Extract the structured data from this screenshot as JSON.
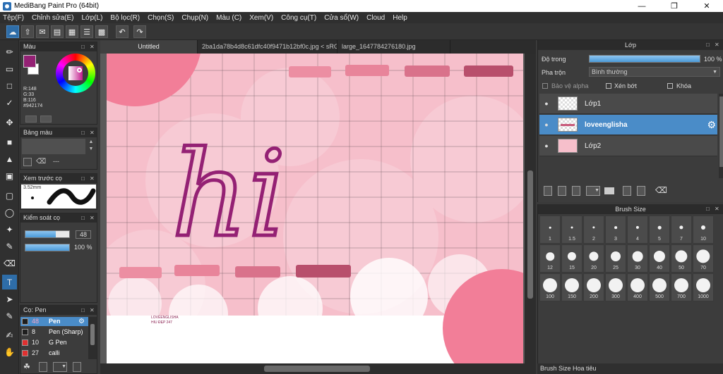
{
  "window": {
    "title": "MediBang Paint Pro (64bit)"
  },
  "menu": [
    "Tệp(F)",
    "Chỉnh sửa(E)",
    "Lớp(L)",
    "Bộ lọc(R)",
    "Chọn(S)",
    "Chụp(N)",
    "Màu (C)",
    "Xem(V)",
    "Công cụ(T)",
    "Cửa sổ(W)",
    "Cloud",
    "Help"
  ],
  "tabs": [
    {
      "label": "Untitled"
    },
    {
      "label": "2ba1da78b4d8c61dfc40f9471b12bf0c.jpg < sRGB >"
    },
    {
      "label": "large_1647784276180.jpg"
    }
  ],
  "color_panel": {
    "title": "Màu",
    "r": "R:148",
    "g": "G:33",
    "b": "B:116",
    "hex": "#942174",
    "primary_color": "#942174",
    "secondary_color": "#ffffff"
  },
  "palette_panel": {
    "title": "Bảng màu",
    "value": "---"
  },
  "brush_preview": {
    "title": "Xem trước cọ",
    "size": "3.52mm"
  },
  "brush_control": {
    "title": "Kiểm soát cọ",
    "size": "48",
    "opacity": "100 %",
    "size_fraction": 0.7,
    "opacity_fraction": 1.0
  },
  "brush_list": {
    "title": "Cọ: Pen",
    "items": [
      {
        "size": "48",
        "name": "Pen",
        "color": "#1e1e1e",
        "selected": true
      },
      {
        "size": "8",
        "name": "Pen (Sharp)",
        "color": "#1e1e1e",
        "selected": false
      },
      {
        "size": "10",
        "name": "G Pen",
        "color": "#e03030",
        "selected": false
      },
      {
        "size": "27",
        "name": "calli",
        "color": "#e03030",
        "selected": false
      }
    ]
  },
  "canvas": {
    "drawn_text": "hi",
    "watermark_line1": "LOVEENGLISHA",
    "watermark_line2": "HIU ĐẸP 247",
    "stroke_color": "#942174",
    "paper_color": "#f6bfcb",
    "grid_color": "#6e5a60",
    "tape_colors": [
      "#ec8ea2",
      "#e8849a",
      "#d9728b",
      "#b84f6c"
    ]
  },
  "layer_panel": {
    "title": "Lớp",
    "opacity_label": "Độ trong",
    "opacity_value": "100 %",
    "opacity_fraction": 1.0,
    "blend_label": "Pha trộn",
    "blend_value": "Bình thường",
    "alpha_protect": "Bảo vệ alpha",
    "clipping": "Xén bớt",
    "lock": "Khóa",
    "layers": [
      {
        "name": "Lớp1",
        "selected": false
      },
      {
        "name": "loveenglisha",
        "selected": true
      },
      {
        "name": "Lớp2",
        "selected": false
      }
    ]
  },
  "brush_size_panel": {
    "title": "Brush Size",
    "sizes": [
      "1",
      "1.5",
      "2",
      "3",
      "4",
      "5",
      "7",
      "10",
      "12",
      "15",
      "20",
      "25",
      "30",
      "40",
      "50",
      "70",
      "100",
      "150",
      "200",
      "300",
      "400",
      "500",
      "700",
      "1000"
    ]
  },
  "bottom_tabs": [
    "Brush Size",
    "Hoa tiêu"
  ]
}
